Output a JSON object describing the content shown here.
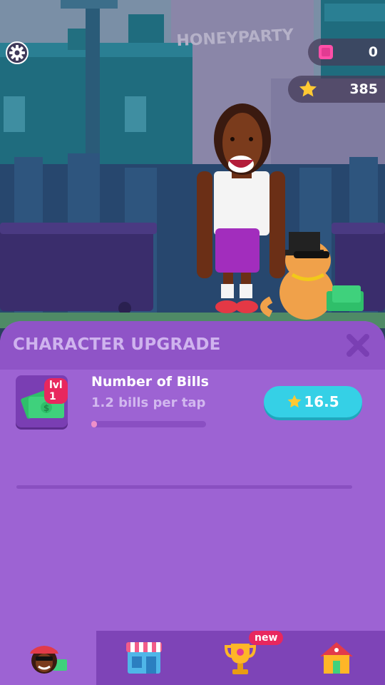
{
  "hud": {
    "gems": "0",
    "stars": "385",
    "sign_text": "HONEYPARTY"
  },
  "panel": {
    "title": "CHARACTER UPGRADE"
  },
  "upgrade": {
    "level": "lvl 1",
    "name": "Number of Bills",
    "description": "1.2 bills per tap",
    "progress": 0.05,
    "cost": "16.5"
  },
  "nav": {
    "tabs": [
      {
        "icon": "character-icon",
        "active": true
      },
      {
        "icon": "shop-icon",
        "active": false
      },
      {
        "icon": "trophy-icon",
        "active": false,
        "badge": "new"
      },
      {
        "icon": "house-icon",
        "active": false
      }
    ]
  },
  "colors": {
    "panel": "#9d63d3",
    "button": "#35d0e6",
    "badge": "#e8275e",
    "star": "#ffc933",
    "gem": "#ff4fa8"
  }
}
